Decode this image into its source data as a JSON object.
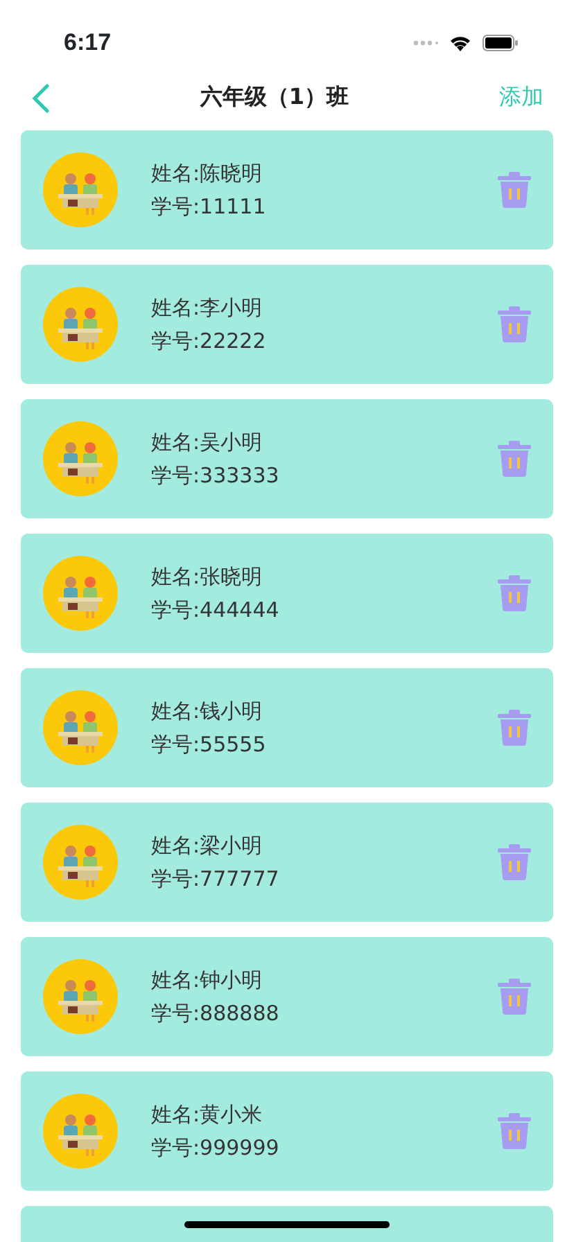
{
  "status_bar": {
    "time": "6:17"
  },
  "nav": {
    "title": "六年级（1）班",
    "action": "添加"
  },
  "students": [
    {
      "name": "姓名:陈晓明",
      "id": "学号:11111"
    },
    {
      "name": "姓名:李小明",
      "id": "学号:22222"
    },
    {
      "name": "姓名:吴小明",
      "id": "学号:333333"
    },
    {
      "name": "姓名:张晓明",
      "id": "学号:444444"
    },
    {
      "name": "姓名:钱小明",
      "id": "学号:55555"
    },
    {
      "name": "姓名:梁小明",
      "id": "学号:777777"
    },
    {
      "name": "姓名:钟小明",
      "id": "学号:888888"
    },
    {
      "name": "姓名:黄小米",
      "id": "学号:999999"
    }
  ],
  "more_below": true
}
